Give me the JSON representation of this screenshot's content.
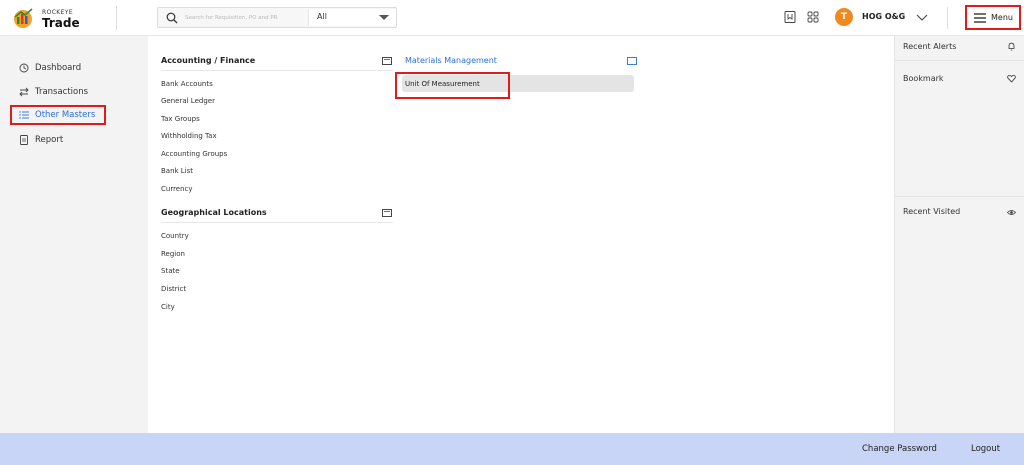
{
  "brand": {
    "small": "ROCKEYE",
    "big": "Trade"
  },
  "search": {
    "placeholder": "Search for Requisition, PO and PR",
    "scope": "All"
  },
  "user": {
    "initial": "T",
    "name": "HOG O&G"
  },
  "menu": {
    "label": "Menu"
  },
  "nav": [
    {
      "label": "Dashboard",
      "icon": "dashboard-icon"
    },
    {
      "label": "Transactions",
      "icon": "transactions-icon"
    },
    {
      "label": "Other Masters",
      "icon": "list-icon",
      "active": true
    },
    {
      "label": "Report",
      "icon": "report-icon"
    }
  ],
  "sections": {
    "accounting": {
      "title": "Accounting / Finance",
      "items": [
        "Bank Accounts",
        "General Ledger",
        "Tax Groups",
        "Withholding Tax",
        "Accounting Groups",
        "Bank List",
        "Currency"
      ]
    },
    "geo": {
      "title": "Geographical Locations",
      "items": [
        "Country",
        "Region",
        "State",
        "District",
        "City"
      ]
    },
    "materials": {
      "title": "Materials Management",
      "items": [
        "Unit Of Measurement"
      ]
    }
  },
  "right_panel": {
    "alerts": "Recent Alerts",
    "bookmark": "Bookmark",
    "visited": "Recent Visited"
  },
  "footer": {
    "change_password": "Change Password",
    "logout": "Logout"
  },
  "colors": {
    "accent": "#2a6fd8",
    "highlight": "#e01b1b",
    "avatar": "#f18a1e",
    "footer": "#c9d5f7"
  }
}
